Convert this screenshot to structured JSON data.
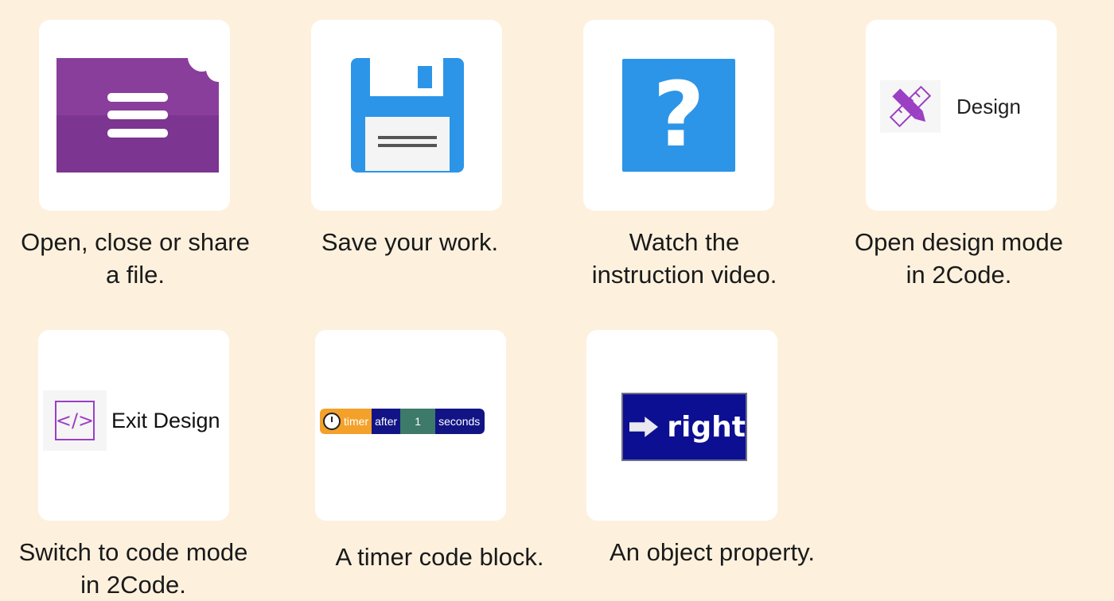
{
  "cards": [
    {
      "caption_lines": [
        "Open, close or share",
        "a file."
      ],
      "icon": "file-menu-icon"
    },
    {
      "caption_lines": [
        "Save your work."
      ],
      "icon": "floppy-disk-icon"
    },
    {
      "caption_lines": [
        "Watch the",
        "instruction video."
      ],
      "icon": "help-icon",
      "glyph": "?"
    },
    {
      "caption_lines": [
        "Open design mode",
        "in 2Code."
      ],
      "icon": "design-pencil-ruler-icon",
      "button_label": "Design"
    },
    {
      "caption_lines": [
        "Switch to code mode",
        "in 2Code."
      ],
      "icon": "code-brackets-icon",
      "glyph": "</>",
      "button_label": "Exit Design"
    },
    {
      "caption_lines": [
        "A timer code block."
      ],
      "icon": "stopwatch-icon",
      "block": {
        "timer": "timer",
        "after": "after",
        "value": "1",
        "unit": "seconds"
      }
    },
    {
      "caption_lines": [
        "An object property."
      ],
      "icon": "arrow-right-icon",
      "button_label": "right"
    }
  ],
  "colors": {
    "background": "#fdf1de",
    "file_purple": "#8a3e9c",
    "save_blue": "#2c95e8",
    "help_blue": "#2c95e8",
    "design_purple": "#9b3fc4",
    "timer_orange": "#f4a12a",
    "block_navy": "#121486"
  }
}
